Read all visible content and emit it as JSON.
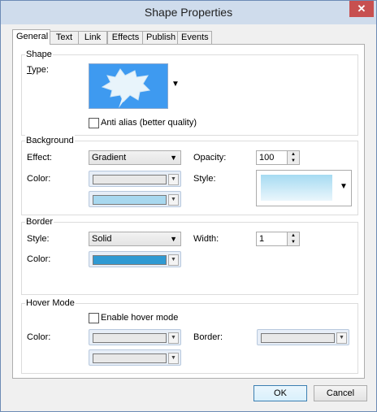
{
  "window": {
    "title": "Shape Properties",
    "close_glyph": "✕"
  },
  "tabs": [
    {
      "label": "General"
    },
    {
      "label": "Text"
    },
    {
      "label": "Link"
    },
    {
      "label": "Effects"
    },
    {
      "label": "Publish"
    },
    {
      "label": "Events"
    }
  ],
  "shape": {
    "group_label": "Shape",
    "type_label": "Type:",
    "antialias_label": "Anti alias (better quality)",
    "antialias_checked": false
  },
  "background": {
    "group_label": "Background",
    "effect_label": "Effect:",
    "effect_value": "Gradient",
    "opacity_label": "Opacity:",
    "opacity_value": "100",
    "color_label": "Color:",
    "style_label": "Style:",
    "color1": "#e8e8e8",
    "color2": "#a8d8ef"
  },
  "border": {
    "group_label": "Border",
    "style_label": "Style:",
    "style_value": "Solid",
    "width_label": "Width:",
    "width_value": "1",
    "color_label": "Color:",
    "color": "#2f9ad3"
  },
  "hover": {
    "group_label": "Hover Mode",
    "enable_label": "Enable hover mode",
    "enable_checked": false,
    "color_label": "Color:",
    "border_label": "Border:"
  },
  "buttons": {
    "ok": "OK",
    "cancel": "Cancel"
  },
  "colors": {
    "shape_bg": "#3e9af0",
    "accent": "#3c7fb1"
  }
}
